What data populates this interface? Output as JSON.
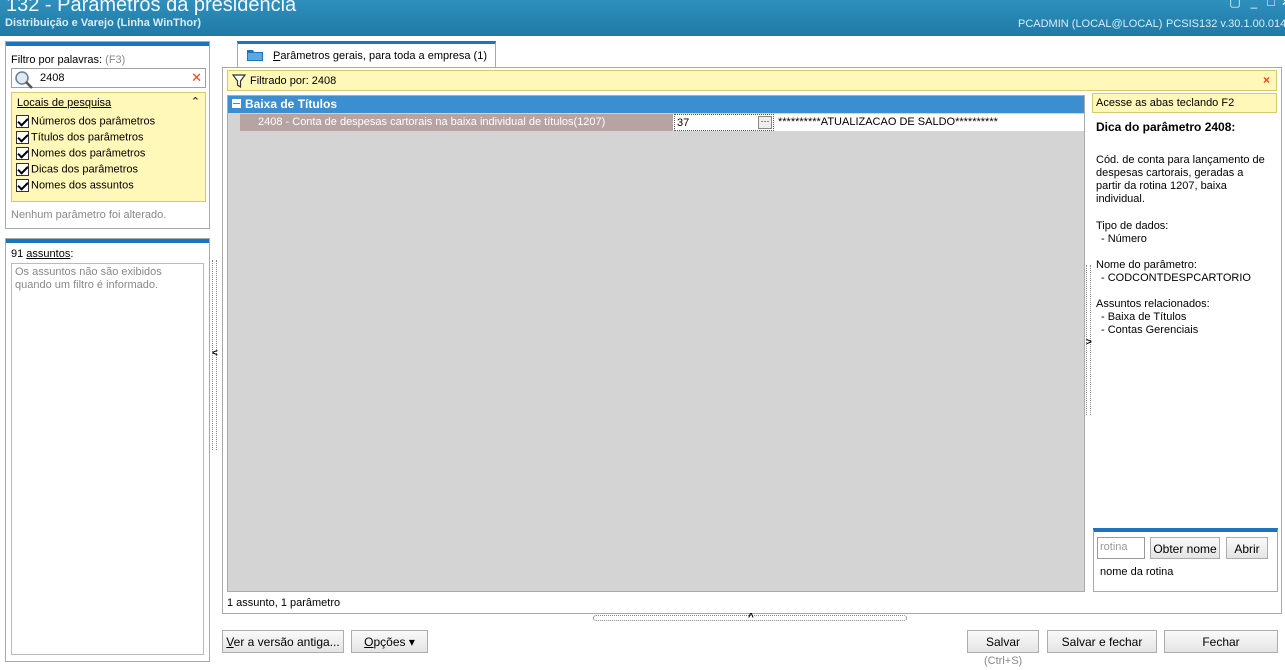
{
  "window": {
    "title": "132 - Parâmetros da presidência",
    "subtitle": "Distribuição e Varejo (Linha WinThor)",
    "user_info": "PCADMIN (LOCAL@LOCAL)",
    "system_info": "PCSIS132  v.30.1.00.014"
  },
  "filter": {
    "label": "Filtro por palavras:",
    "shortcut": "(F3)",
    "value": "2408",
    "locations_title": "Locais de pesquisa",
    "locations": [
      "Números dos parâmetros",
      "Títulos dos parâmetros",
      "Nomes dos parâmetros",
      "Dicas dos parâmetros",
      "Nomes dos assuntos"
    ],
    "no_change_text": "Nenhum parâmetro foi alterado."
  },
  "subjects": {
    "count_prefix": "91 ",
    "count_label": "assuntos",
    "count_suffix": ":",
    "empty_text": "Os assuntos não são exibidos quando um filtro é informado."
  },
  "tab": {
    "label_first": "P",
    "label_rest": "arâmetros gerais, para toda a empresa  (1)"
  },
  "filter_bar": {
    "text": "Filtrado por: 2408",
    "close": "×"
  },
  "grid": {
    "group_title": "Baixa de Títulos",
    "rows": [
      {
        "name": "2408 - Conta de despesas cartorais na baixa individual de títulos(1207)",
        "value": "37",
        "description": "**********ATUALIZACAO DE SALDO**********"
      }
    ]
  },
  "status": "1 assunto, 1 parâmetro",
  "side_panel": {
    "hint": "Acesse as abas teclando F2",
    "tip_title": "Dica do parâmetro 2408:",
    "tip_text": "Cód. de conta para lançamento de despesas cartorais, geradas a partir da rotina 1207, baixa individual.",
    "data_type_label": "Tipo de dados:",
    "data_type_value": "- Número",
    "param_name_label": "Nome do parâmetro:",
    "param_name_value": "- CODCONTDESPCARTORIO",
    "related_label": "Assuntos relacionados:",
    "related": [
      "- Baixa de Títulos",
      "- Contas Gerenciais"
    ]
  },
  "routine": {
    "placeholder": "rotina",
    "get_name_button": "Obter nome",
    "open_button": "Abrir",
    "name_text": "nome da rotina"
  },
  "footer": {
    "old_version_first": "V",
    "old_version_rest": "er a versão antiga...",
    "options_first": "O",
    "options_rest": "pções",
    "save": "Salvar",
    "save_shortcut": "(Ctrl+S)",
    "save_close": "Salvar e fechar",
    "close": "Fechar"
  }
}
